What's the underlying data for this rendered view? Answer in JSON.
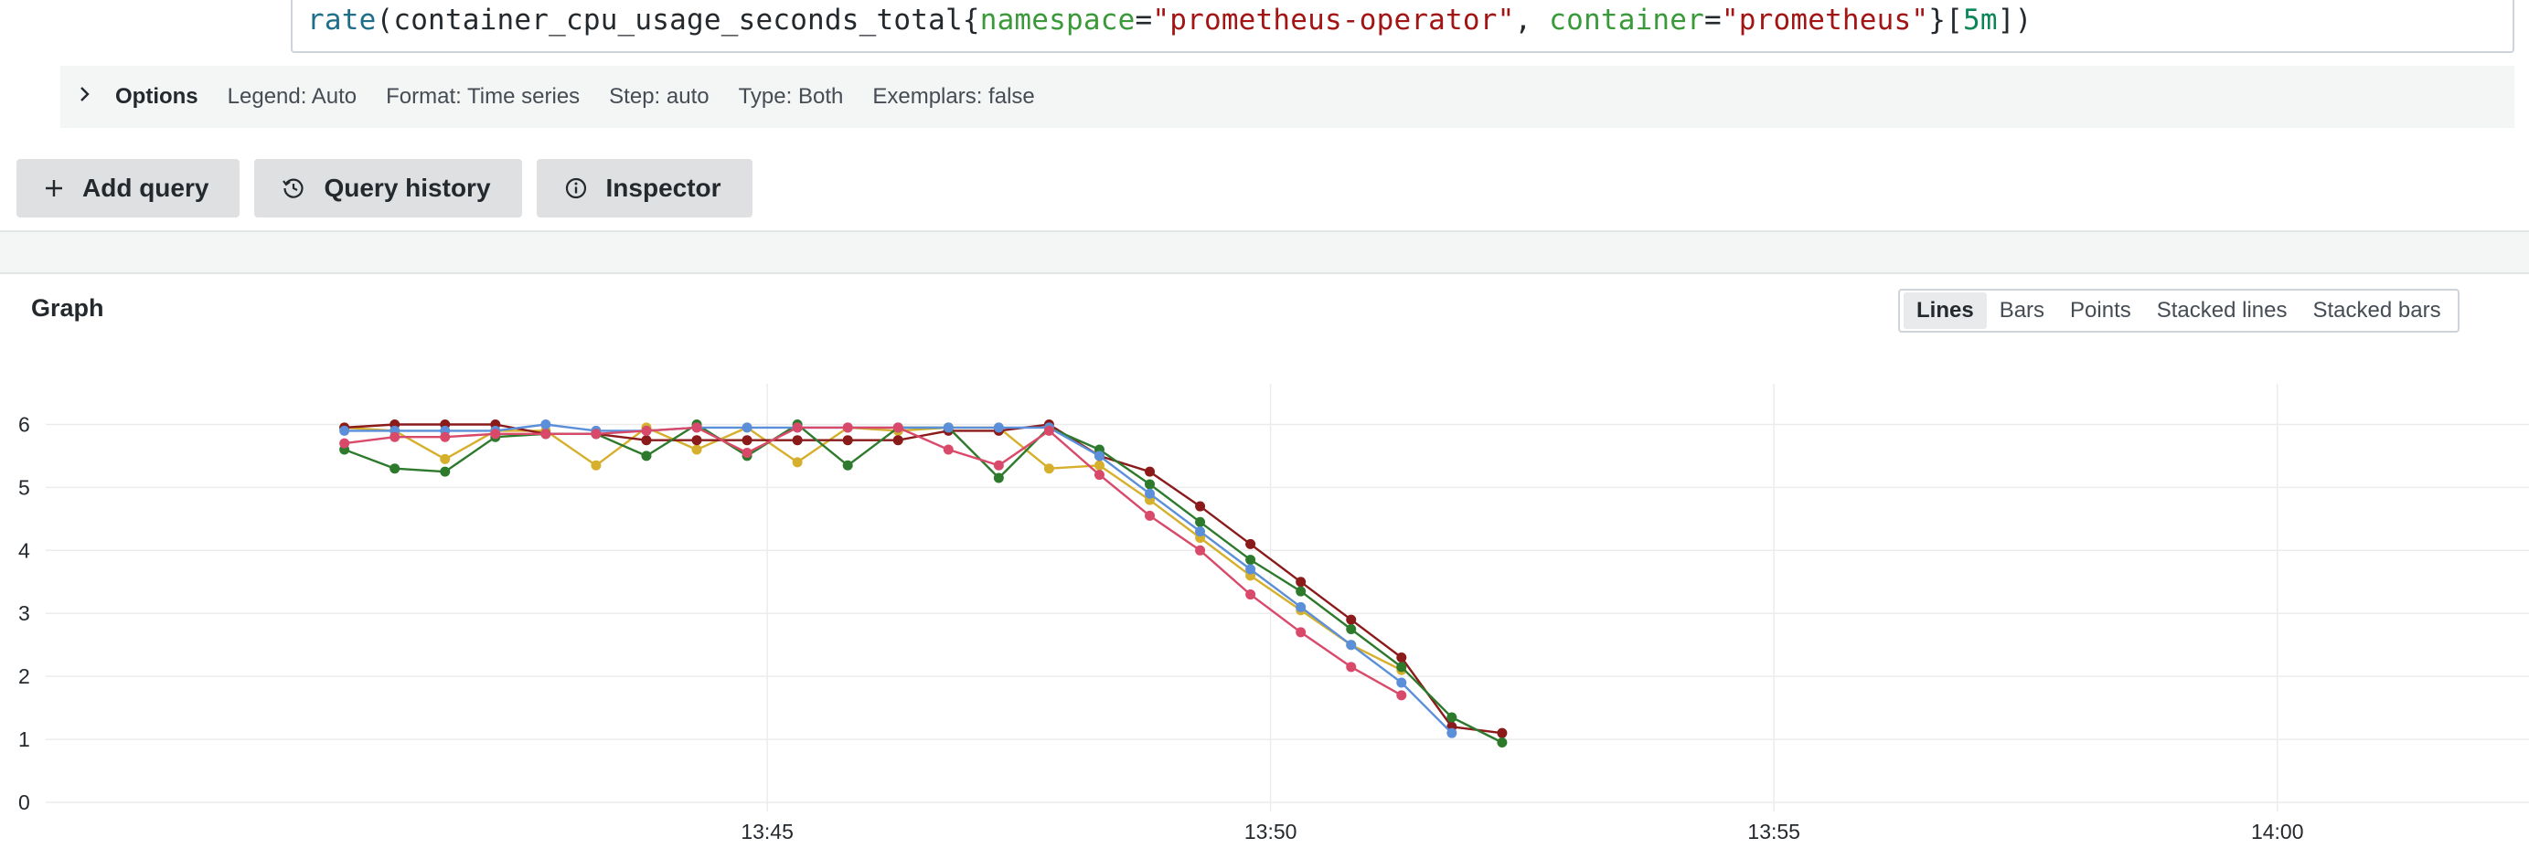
{
  "query": {
    "tokens": [
      {
        "t": "rate",
        "c": "fn"
      },
      {
        "t": "(container_cpu_usage_seconds_total{",
        "c": ""
      },
      {
        "t": "namespace",
        "c": "label"
      },
      {
        "t": "=",
        "c": ""
      },
      {
        "t": "\"prometheus-operator\"",
        "c": "str"
      },
      {
        "t": ", ",
        "c": ""
      },
      {
        "t": "container",
        "c": "label"
      },
      {
        "t": "=",
        "c": ""
      },
      {
        "t": "\"prometheus\"",
        "c": "str"
      },
      {
        "t": "}[",
        "c": ""
      },
      {
        "t": "5m",
        "c": "num"
      },
      {
        "t": "])",
        "c": ""
      }
    ]
  },
  "options": {
    "title": "Options",
    "legend": "Legend: Auto",
    "format": "Format: Time series",
    "step": "Step: auto",
    "type": "Type: Both",
    "exemplars": "Exemplars: false"
  },
  "buttons": {
    "add_query": "Add query",
    "query_history": "Query history",
    "inspector": "Inspector"
  },
  "graph": {
    "title": "Graph",
    "view_modes": [
      "Lines",
      "Bars",
      "Points",
      "Stacked lines",
      "Stacked bars"
    ],
    "active_mode": "Lines"
  },
  "chart_data": {
    "type": "line",
    "title": "",
    "xlabel": "",
    "ylabel": "",
    "x_ticks": [
      "13:45",
      "13:50",
      "13:55",
      "14:00"
    ],
    "y_ticks": [
      0,
      1,
      2,
      3,
      4,
      5,
      6
    ],
    "ylim": [
      0,
      6.5
    ],
    "x_unit": "minutes after 13:45",
    "xlim": [
      -4.3,
      3.0
    ],
    "grid": true,
    "series": [
      {
        "color": "#d6b02c",
        "x": [
          -4.2,
          -3.7,
          -3.2,
          -2.7,
          -2.2,
          -1.7,
          -1.2,
          -0.7,
          -0.2,
          0.3,
          0.8,
          1.3,
          1.8,
          2.3,
          2.8,
          3.3,
          3.8,
          4.3,
          4.8,
          5.3,
          5.8,
          6.3,
          6.8,
          7.3
        ],
        "y": [
          5.95,
          5.9,
          5.45,
          5.9,
          5.9,
          5.35,
          5.95,
          5.6,
          5.95,
          5.4,
          5.95,
          5.9,
          5.95,
          5.95,
          5.3,
          5.35,
          4.8,
          4.2,
          3.6,
          3.05,
          2.5,
          2.1,
          null,
          null
        ]
      },
      {
        "color": "#8b1a1a",
        "x": [
          -4.2,
          -3.7,
          -3.2,
          -2.7,
          -2.2,
          -1.7,
          -1.2,
          -0.7,
          -0.2,
          0.3,
          0.8,
          1.3,
          1.8,
          2.3,
          2.8,
          3.3,
          3.8,
          4.3,
          4.8,
          5.3,
          5.8,
          6.3,
          6.8,
          7.3
        ],
        "y": [
          5.95,
          6.0,
          6.0,
          6.0,
          5.85,
          5.85,
          5.75,
          5.75,
          5.75,
          5.75,
          5.75,
          5.75,
          5.9,
          5.9,
          6.0,
          5.5,
          5.25,
          4.7,
          4.1,
          3.5,
          2.9,
          2.3,
          1.2,
          1.1
        ]
      },
      {
        "color": "#2d7a2d",
        "x": [
          -4.2,
          -3.7,
          -3.2,
          -2.7,
          -2.2,
          -1.7,
          -1.2,
          -0.7,
          -0.2,
          0.3,
          0.8,
          1.3,
          1.8,
          2.3,
          2.8,
          3.3,
          3.8,
          4.3,
          4.8,
          5.3,
          5.8,
          6.3,
          6.8,
          7.3
        ],
        "y": [
          5.6,
          5.3,
          5.25,
          5.8,
          5.85,
          5.85,
          5.5,
          6.0,
          5.5,
          6.0,
          5.35,
          5.95,
          5.95,
          5.15,
          5.95,
          5.6,
          5.05,
          4.45,
          3.85,
          3.35,
          2.75,
          2.15,
          1.35,
          0.95
        ]
      },
      {
        "color": "#5b8fd9",
        "x": [
          -4.2,
          -3.7,
          -3.2,
          -2.7,
          -2.2,
          -1.7,
          -1.2,
          -0.7,
          -0.2,
          0.3,
          0.8,
          1.3,
          1.8,
          2.3,
          2.8,
          3.3,
          3.8,
          4.3,
          4.8,
          5.3,
          5.8,
          6.3,
          6.8,
          7.3
        ],
        "y": [
          5.9,
          5.9,
          5.9,
          5.9,
          6.0,
          5.9,
          5.9,
          5.95,
          5.95,
          5.95,
          5.95,
          5.95,
          5.95,
          5.95,
          5.95,
          5.5,
          4.9,
          4.3,
          3.7,
          3.1,
          2.5,
          1.9,
          1.1,
          null
        ]
      },
      {
        "color": "#d94a6a",
        "x": [
          -4.2,
          -3.7,
          -3.2,
          -2.7,
          -2.2,
          -1.7,
          -1.2,
          -0.7,
          -0.2,
          0.3,
          0.8,
          1.3,
          1.8,
          2.3,
          2.8,
          3.3,
          3.8,
          4.3,
          4.8,
          5.3,
          5.8,
          6.3,
          6.8,
          7.3
        ],
        "y": [
          5.7,
          5.8,
          5.8,
          5.85,
          5.85,
          5.85,
          5.9,
          5.95,
          5.55,
          5.95,
          5.95,
          5.95,
          5.6,
          5.35,
          5.9,
          5.2,
          4.55,
          4.0,
          3.3,
          2.7,
          2.15,
          1.7,
          null,
          null
        ]
      }
    ]
  }
}
